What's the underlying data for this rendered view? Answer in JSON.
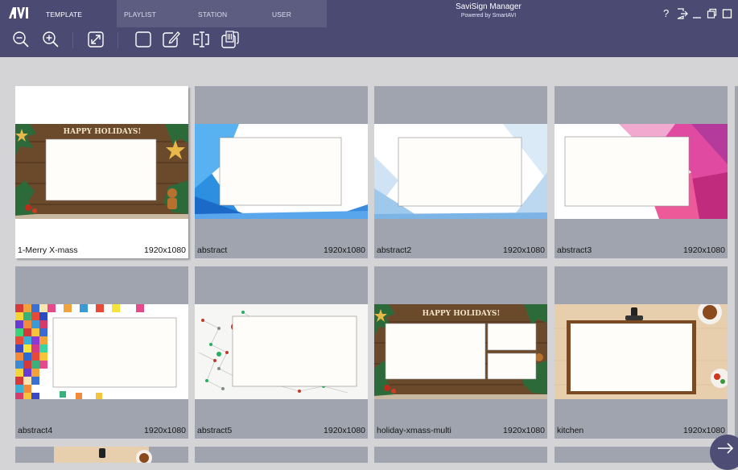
{
  "app": {
    "logo_text": "AVI",
    "title": "SaviSign Manager",
    "subtitle": "Powered by SmartAVI"
  },
  "nav": {
    "tabs": [
      {
        "label": "TEMPLATE MANAGER",
        "active": true
      },
      {
        "label": "PLAYLIST MANAGER",
        "active": false
      },
      {
        "label": "STATION MANAGER",
        "active": false
      },
      {
        "label": "USER MANAGER",
        "active": false
      }
    ]
  },
  "window_controls": [
    "help-icon",
    "logout-icon",
    "minimize-icon",
    "restore-icon",
    "maximize-icon"
  ],
  "window_control_glyphs": {
    "help": "?"
  },
  "toolbar": [
    "zoom-out-icon",
    "zoom-in-icon",
    "fullscreen-icon",
    "new-template-icon",
    "edit-template-icon",
    "rename-template-icon",
    "delete-template-icon"
  ],
  "colors": {
    "header": "#4b4a72",
    "nav_inactive": "#5d5d82",
    "workspace": "#d4d4d7",
    "card": "#a0a4af",
    "card_selected": "#ffffff"
  },
  "templates": [
    {
      "name": "1-Merry X-mass",
      "resolution": "1920x1080",
      "banner": "HAPPY HOLIDAYS!",
      "selected": true
    },
    {
      "name": "abstract",
      "resolution": "1920x1080"
    },
    {
      "name": "abstract2",
      "resolution": "1920x1080"
    },
    {
      "name": "abstract3",
      "resolution": "1920x1080"
    },
    {
      "name": "abstract4",
      "resolution": "1920x1080"
    },
    {
      "name": "abstract5",
      "resolution": "1920x1080"
    },
    {
      "name": "holiday-xmass-multi",
      "resolution": "1920x1080",
      "banner": "HAPPY HOLIDAYS!"
    },
    {
      "name": "kitchen",
      "resolution": "1920x1080"
    }
  ],
  "fab_icon": "arrow-right-icon"
}
